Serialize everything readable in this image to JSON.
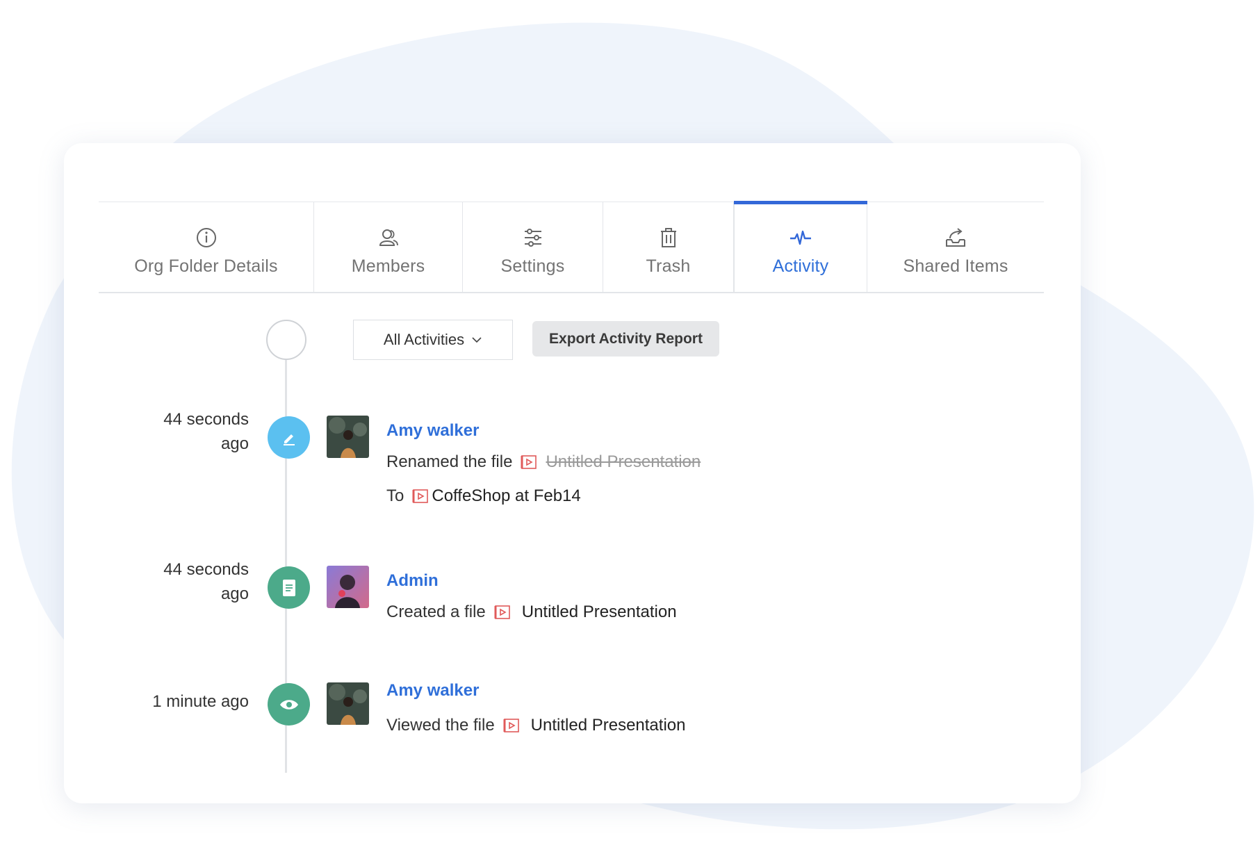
{
  "tabs": [
    {
      "label": "Org Folder Details",
      "icon": "info-icon",
      "active": false
    },
    {
      "label": "Members",
      "icon": "members-icon",
      "active": false
    },
    {
      "label": "Settings",
      "icon": "sliders-icon",
      "active": false
    },
    {
      "label": "Trash",
      "icon": "trash-icon",
      "active": false
    },
    {
      "label": "Activity",
      "icon": "activity-icon",
      "active": true
    },
    {
      "label": "Shared Items",
      "icon": "shared-icon",
      "active": false
    }
  ],
  "toolbar": {
    "filter_label": "All Activities",
    "export_label": "Export Activity Report"
  },
  "activities": [
    {
      "time_line1": "44 seconds",
      "time_line2": "ago",
      "type_icon": "edit-icon",
      "user": "Amy walker",
      "action": "Renamed the file",
      "old_name": "Untitled Presentation",
      "to_label": "To",
      "new_name": "CoffeShop at Feb14"
    },
    {
      "time_line1": "44 seconds",
      "time_line2": "ago",
      "type_icon": "document-icon",
      "user": "Admin",
      "action": "Created a file",
      "file_name": "Untitled Presentation"
    },
    {
      "time": "1 minute ago",
      "type_icon": "eye-icon",
      "user": "Amy walker",
      "action": "Viewed the file",
      "file_name": "Untitled Presentation"
    }
  ],
  "colors": {
    "accent": "#2f6fd9",
    "edit": "#5bc0f0",
    "document": "#4caa8a",
    "view": "#4caa8a",
    "file_icon": "#e05a5a"
  }
}
